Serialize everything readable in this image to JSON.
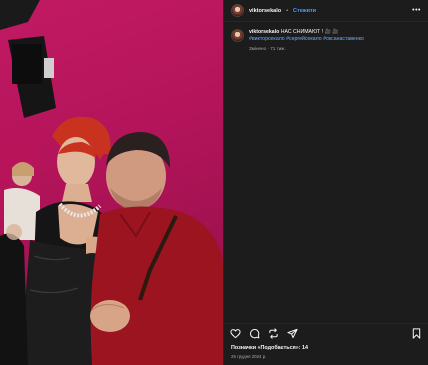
{
  "post": {
    "author": {
      "username": "viktorsekalo",
      "separator": "•",
      "follow_label": "Стежити",
      "more_label": "•••"
    },
    "caption": {
      "username": "viktorsekalo",
      "text": "НАС СНИМАЮТ ! 🎥 🎥",
      "hashtags": "#викторсекало #сергейсекало #оксанаставенко",
      "meta": "Змінено · 71 тиж."
    },
    "likes_text": "Позначки «Подобається»: 14",
    "date_text": "25 грудня 2024 р."
  },
  "icons": {
    "like": "heart-icon",
    "comment": "comment-icon",
    "repost": "repost-icon",
    "share": "share-icon",
    "save": "bookmark-icon",
    "more": "more-icon"
  },
  "colors": {
    "panel_bg": "#1c1c1c",
    "follow_blue": "#4a9cff",
    "hashtag_blue": "#6ab0ff",
    "photo_backdrop": "#c21a64"
  }
}
